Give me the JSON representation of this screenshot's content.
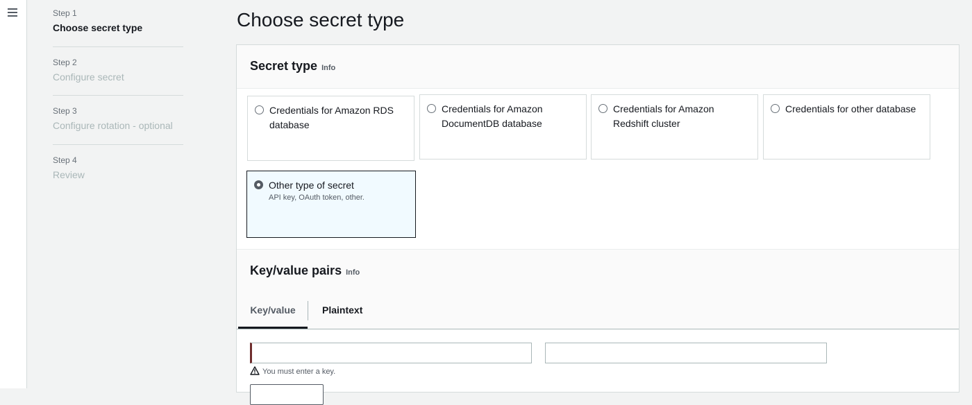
{
  "steps": [
    {
      "number": "Step 1",
      "title": "Choose secret type"
    },
    {
      "number": "Step 2",
      "title": "Configure secret"
    },
    {
      "number": "Step 3",
      "title": "Configure rotation - optional"
    },
    {
      "number": "Step 4",
      "title": "Review"
    }
  ],
  "page_title": "Choose secret type",
  "secret_type": {
    "heading": "Secret type",
    "info": "Info",
    "options": [
      {
        "label": "Credentials for Amazon RDS database",
        "selected": false
      },
      {
        "label": "Credentials for Amazon DocumentDB database",
        "selected": false
      },
      {
        "label": "Credentials for Amazon Redshift cluster",
        "selected": false
      },
      {
        "label": "Credentials for other database",
        "selected": false
      },
      {
        "label": "Other type of secret",
        "description": "API key, OAuth token, other.",
        "selected": true
      }
    ]
  },
  "kv_pairs": {
    "heading": "Key/value pairs",
    "info": "Info",
    "tabs": [
      "Key/value",
      "Plaintext"
    ],
    "active_tab": "Key/value",
    "key_value": "",
    "value_value": "",
    "error": "You must enter a key."
  },
  "colors": {
    "error_accent": "#6f2e2e",
    "selected_tile_bg": "#f1faff"
  }
}
